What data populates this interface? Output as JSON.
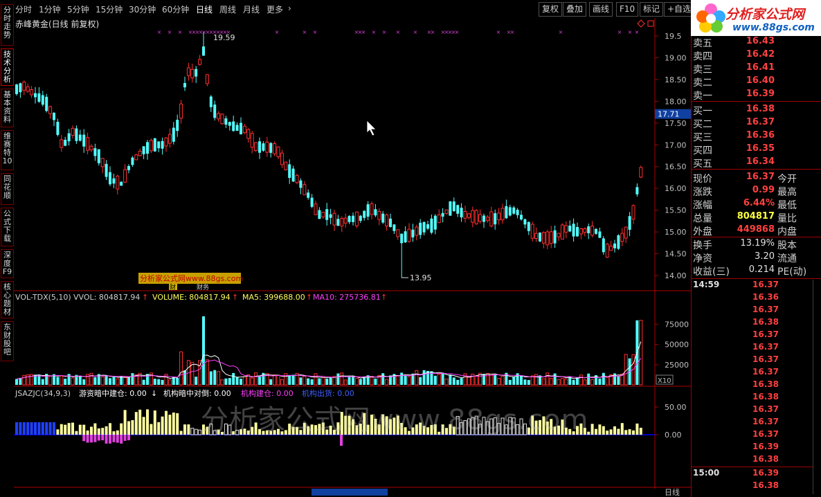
{
  "toolbar": {
    "periods": [
      "分时",
      "1分钟",
      "5分钟",
      "15分钟",
      "30分钟",
      "60分钟",
      "日线",
      "周线",
      "月线",
      "更多"
    ],
    "active_period": "日线",
    "right_buttons": [
      "复权",
      "叠加",
      "画线",
      "F10",
      "标记",
      "+自选"
    ]
  },
  "side_tabs": [
    "分时走势",
    "技术分析",
    "基本资料",
    "维赛特10",
    "同花顺",
    "公式下载",
    "深度F9",
    "核心题材",
    "东财股吧"
  ],
  "stock": {
    "title": "赤峰黄金(日线 前复权)"
  },
  "price_axis": [
    "19.5",
    "19.00",
    "18.50",
    "18.00",
    "17.50",
    "17.00",
    "16.50",
    "16.00",
    "15.50",
    "15.00",
    "14.50",
    "14.00"
  ],
  "price_marker": "17.71",
  "annotations": {
    "high": "19.59",
    "low": "13.95",
    "site_label": "分析家公式网www.88gs.com",
    "tag1": "财",
    "tag2": "财务"
  },
  "vol_panel": {
    "name": "VOL-TDX(5,10)",
    "vvol": "VVOL: 804817.94",
    "volume": "VOLUME: 804817.94",
    "ma5": "MA5: 399688.00",
    "ma10": "MA10: 275736.81",
    "axis": [
      "75000",
      "50000",
      "25000"
    ],
    "unit": "X10"
  },
  "ind_panel": {
    "name": "JSAZJC(34,9,3)",
    "l1": "游资暗中建仓: 0.00",
    "l2": "机构暗中对倒: 0.00",
    "l3": "机构建仓: 0.00",
    "l4": "机构出货: 0.00",
    "axis": [
      "50.00",
      "0.00"
    ]
  },
  "bottom_right": "日线",
  "quote": {
    "sell": [
      {
        "label": "卖五",
        "price": "16.43"
      },
      {
        "label": "卖四",
        "price": "16.42"
      },
      {
        "label": "卖三",
        "price": "16.41"
      },
      {
        "label": "卖二",
        "price": "16.40"
      },
      {
        "label": "卖一",
        "price": "16.39"
      }
    ],
    "buy": [
      {
        "label": "买一",
        "price": "16.38"
      },
      {
        "label": "买二",
        "price": "16.37"
      },
      {
        "label": "买三",
        "price": "16.36"
      },
      {
        "label": "买四",
        "price": "16.35"
      },
      {
        "label": "买五",
        "price": "16.34"
      }
    ],
    "stats": [
      {
        "label": "现价",
        "value": "16.37",
        "label2": "今开",
        "color": "#ff4040"
      },
      {
        "label": "涨跌",
        "value": "0.99",
        "label2": "最高",
        "color": "#ff4040"
      },
      {
        "label": "涨幅",
        "value": "6.44%",
        "label2": "最低",
        "color": "#ff4040"
      },
      {
        "label": "总量",
        "value": "804817",
        "label2": "量比",
        "color": "#ffff40"
      },
      {
        "label": "外盘",
        "value": "449868",
        "label2": "内盘",
        "color": "#ff4040"
      }
    ],
    "stats2": [
      {
        "label": "换手",
        "value": "13.19%",
        "label2": "股本"
      },
      {
        "label": "净资",
        "value": "3.20",
        "label2": "流通"
      },
      {
        "label": "收益(三)",
        "value": "0.214",
        "label2": "PE(动)"
      }
    ],
    "time1": "14:59",
    "ticks1": [
      "16.37",
      "16.36",
      "16.37",
      "16.38",
      "16.37",
      "16.37",
      "16.37",
      "16.37",
      "16.38",
      "16.38",
      "16.37",
      "16.37",
      "16.37",
      "16.39",
      "16.38"
    ],
    "time2": "15:00",
    "ticks2": [
      "16.39",
      "16.38"
    ]
  },
  "watermark": "分析家公式网www.88gs.com",
  "logo": {
    "text": "分析家公式网",
    "url": "www.88gs.com"
  }
}
